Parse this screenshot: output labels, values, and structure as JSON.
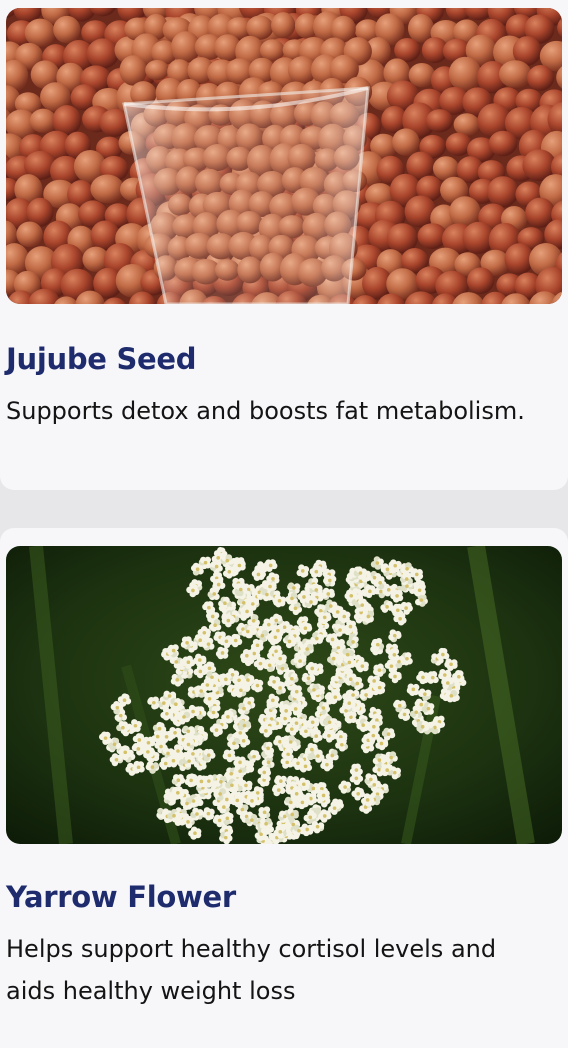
{
  "cards": [
    {
      "title": "Jujube Seed",
      "description": "Supports detox and boosts fat metabolism.",
      "image": "jujube-seeds-in-cup"
    },
    {
      "title": "Yarrow Flower",
      "description": "Helps support healthy cortisol levels and aids healthy weight loss",
      "image": "white-yarrow-flower-cluster"
    }
  ]
}
